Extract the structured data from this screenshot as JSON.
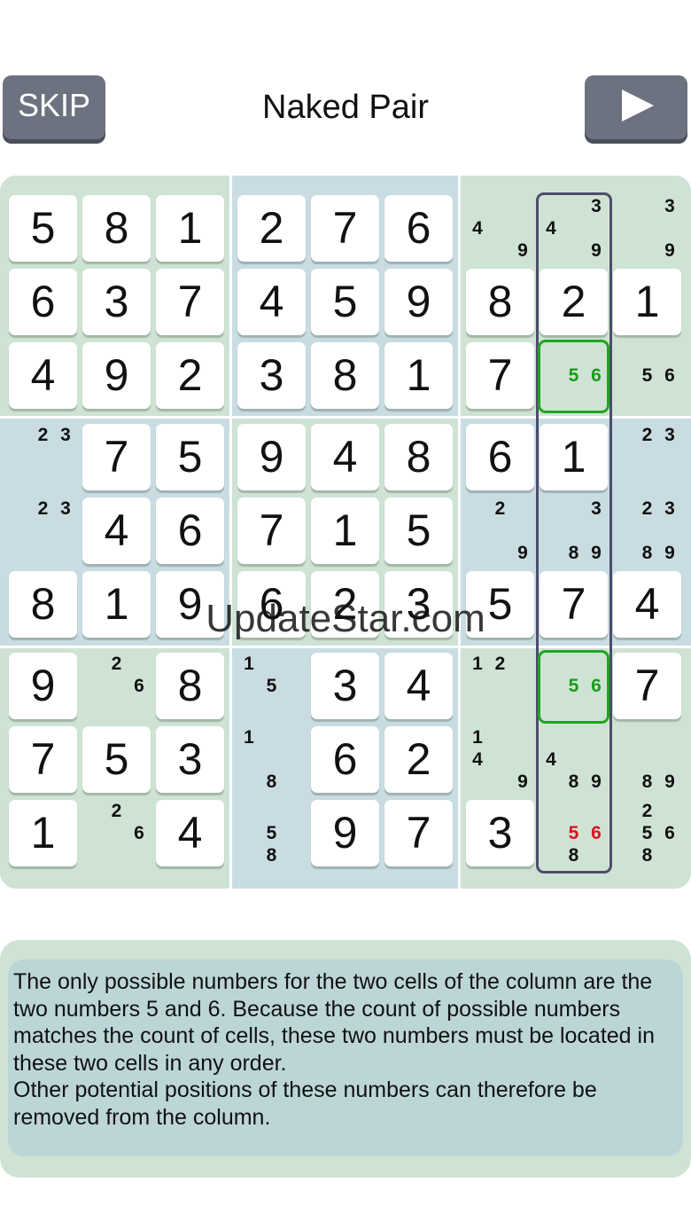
{
  "header": {
    "skip_label": "SKIP",
    "title": "Naked Pair",
    "next_icon": "play-triangle-icon"
  },
  "board": {
    "rows": [
      [
        {
          "v": "5"
        },
        {
          "v": "8"
        },
        {
          "v": "1"
        },
        {
          "v": "2"
        },
        {
          "v": "7"
        },
        {
          "v": "6"
        },
        {
          "c": [
            "4",
            "9"
          ]
        },
        {
          "c": [
            "3",
            "4",
            "9"
          ]
        },
        {
          "c": [
            "3",
            "9"
          ]
        }
      ],
      [
        {
          "v": "6"
        },
        {
          "v": "3"
        },
        {
          "v": "7"
        },
        {
          "v": "4"
        },
        {
          "v": "5"
        },
        {
          "v": "9"
        },
        {
          "v": "8"
        },
        {
          "v": "2"
        },
        {
          "v": "1"
        }
      ],
      [
        {
          "v": "4"
        },
        {
          "v": "9"
        },
        {
          "v": "2"
        },
        {
          "v": "3"
        },
        {
          "v": "8"
        },
        {
          "v": "1"
        },
        {
          "v": "7"
        },
        {
          "c": [
            "5",
            "6"
          ],
          "hl": "green"
        },
        {
          "c": [
            "5",
            "6"
          ]
        }
      ],
      [
        {
          "c": [
            "2",
            "3"
          ]
        },
        {
          "v": "7"
        },
        {
          "v": "5"
        },
        {
          "v": "9"
        },
        {
          "v": "4"
        },
        {
          "v": "8"
        },
        {
          "v": "6"
        },
        {
          "v": "1"
        },
        {
          "c": [
            "2",
            "3"
          ]
        }
      ],
      [
        {
          "c": [
            "2",
            "3"
          ]
        },
        {
          "v": "4"
        },
        {
          "v": "6"
        },
        {
          "v": "7"
        },
        {
          "v": "1"
        },
        {
          "v": "5"
        },
        {
          "c": [
            "2",
            "9"
          ]
        },
        {
          "c": [
            "3",
            "8",
            "9"
          ]
        },
        {
          "c": [
            "2",
            "3",
            "8",
            "9"
          ]
        }
      ],
      [
        {
          "v": "8"
        },
        {
          "v": "1"
        },
        {
          "v": "9"
        },
        {
          "v": "6"
        },
        {
          "v": "2"
        },
        {
          "v": "3"
        },
        {
          "v": "5"
        },
        {
          "v": "7"
        },
        {
          "v": "4"
        }
      ],
      [
        {
          "v": "9"
        },
        {
          "c": [
            "2",
            "6"
          ]
        },
        {
          "v": "8"
        },
        {
          "c": [
            "1",
            "5"
          ]
        },
        {
          "v": "3"
        },
        {
          "v": "4"
        },
        {
          "c": [
            "1",
            "2"
          ]
        },
        {
          "c": [
            "5",
            "6"
          ],
          "hl": "green"
        },
        {
          "v": "7"
        }
      ],
      [
        {
          "v": "7"
        },
        {
          "v": "5"
        },
        {
          "v": "3"
        },
        {
          "c": [
            "1",
            "8"
          ]
        },
        {
          "v": "6"
        },
        {
          "v": "2"
        },
        {
          "c": [
            "1",
            "4",
            "9"
          ]
        },
        {
          "c": [
            "4",
            "8",
            "9"
          ]
        },
        {
          "c": [
            "8",
            "9"
          ]
        }
      ],
      [
        {
          "v": "1"
        },
        {
          "c": [
            "2",
            "6"
          ]
        },
        {
          "v": "4"
        },
        {
          "c": [
            "5",
            "8"
          ]
        },
        {
          "v": "9"
        },
        {
          "v": "7"
        },
        {
          "v": "3"
        },
        {
          "c": [
            "5",
            "6",
            "8"
          ],
          "red": [
            "5",
            "6"
          ]
        },
        {
          "c": [
            "2",
            "5",
            "6",
            "8"
          ]
        }
      ]
    ],
    "box_colors": [
      "green",
      "blue",
      "green",
      "blue",
      "green",
      "blue",
      "green",
      "blue",
      "green"
    ],
    "colors": {
      "green_box": "#cfe3d4",
      "blue_box": "#c9dce2",
      "pair_highlight": "#1ea61e",
      "column_outline": "#4b4d6a",
      "removed_candidate": "#e0101e"
    }
  },
  "watermark": "UpdateStar.com",
  "explanation": "The only possible numbers for the two cells of the column are the two numbers 5 and 6. Because the count of possible numbers matches the count of cells, these two numbers must be located in these two cells in any order.\nOther potential positions of these numbers can therefore be removed from the column."
}
